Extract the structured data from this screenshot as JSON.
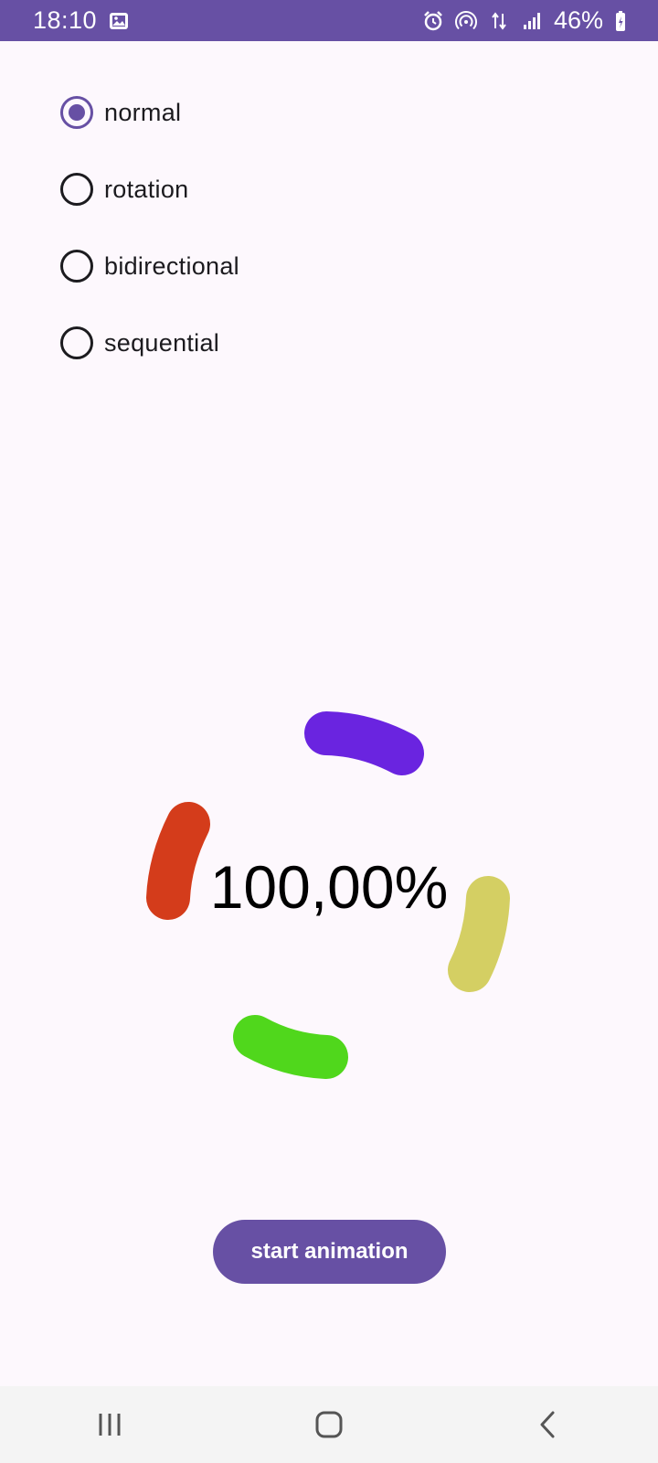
{
  "status_bar": {
    "time": "18:10",
    "battery": "46%",
    "icons": [
      "gallery-icon",
      "alarm-icon",
      "hotspot-icon",
      "data-icon",
      "signal-icon",
      "battery-icon"
    ],
    "background": "#6750a4"
  },
  "radio_options": {
    "selected": "normal",
    "items": [
      {
        "label": "normal",
        "selected": true
      },
      {
        "label": "rotation",
        "selected": false
      },
      {
        "label": "bidirectional",
        "selected": false
      },
      {
        "label": "sequential",
        "selected": false
      }
    ]
  },
  "progress": {
    "text": "100,00%",
    "value": 1.0,
    "segment_colors": [
      "#6a24e0",
      "#d4cf63",
      "#50d71c",
      "#d43c1b"
    ]
  },
  "buttons": {
    "start_animation": "start animation"
  },
  "nav_bar": {
    "icons": [
      "recents-icon",
      "home-icon",
      "back-icon"
    ]
  },
  "colors": {
    "accent": "#6750a4",
    "background": "#fdf8fd"
  }
}
